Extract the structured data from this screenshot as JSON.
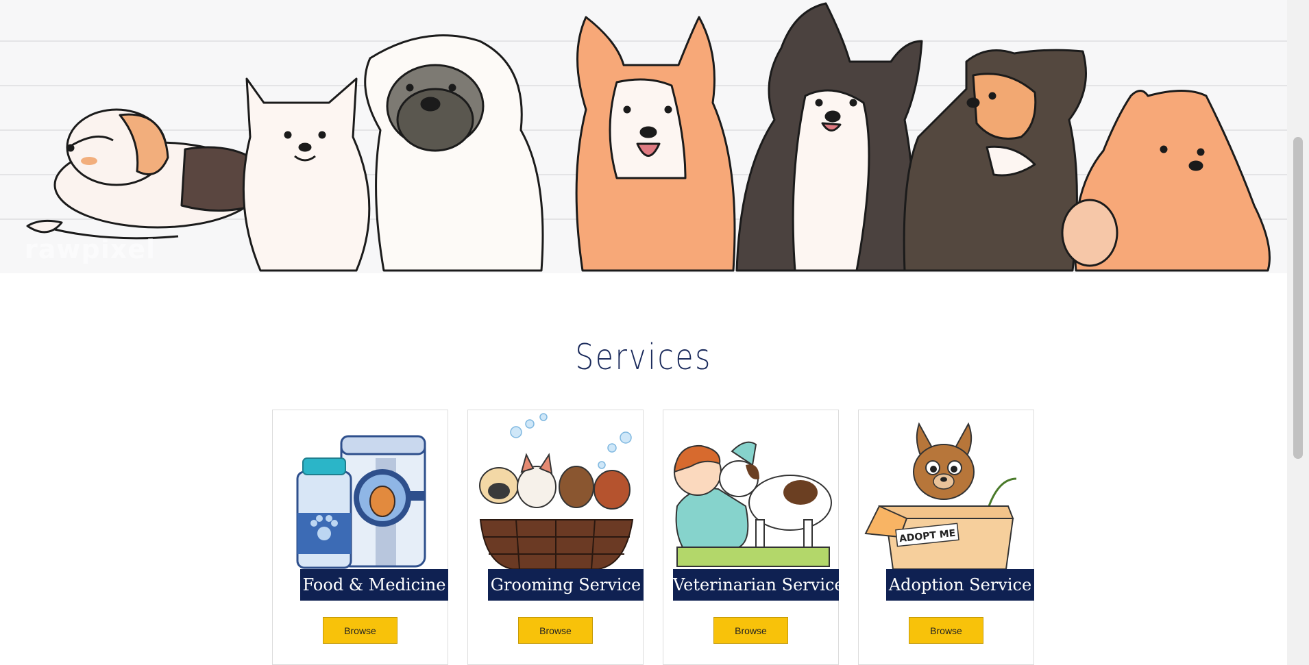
{
  "hero": {
    "watermark": "rawpixel",
    "image": "cartoon-dogs-lineup-illustration"
  },
  "services": {
    "title": "Services",
    "cards": [
      {
        "label": "Food & Medicine",
        "button": "Browse",
        "icon": "pet-food-can-and-medicine-bottle"
      },
      {
        "label": "Grooming Service",
        "button": "Browse",
        "icon": "puppies-in-bath-tub"
      },
      {
        "label": "Veterinarian Service",
        "button": "Browse",
        "icon": "vet-examining-dog"
      },
      {
        "label": "Adoption Service",
        "button": "Browse",
        "icon": "puppy-in-adopt-me-box"
      }
    ],
    "box_text": "ADOPT ME"
  },
  "colors": {
    "navy": "#0f2152",
    "title": "#1a2a5b",
    "button_yellow": "#f8c20a"
  }
}
